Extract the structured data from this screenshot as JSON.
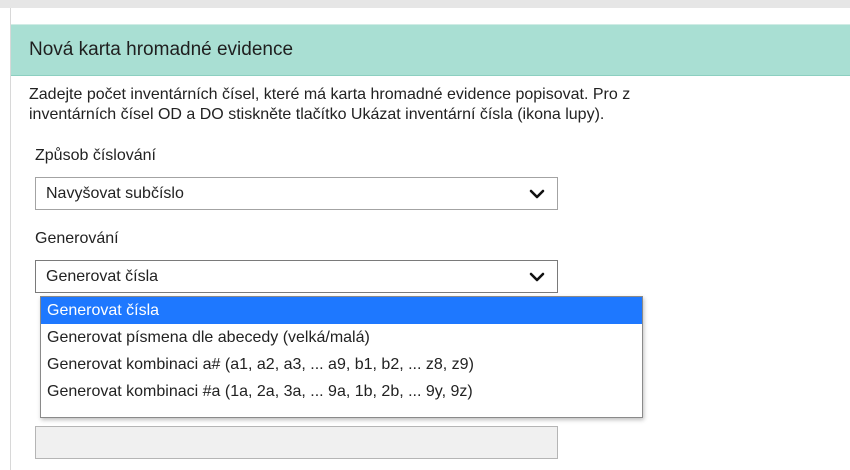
{
  "panel": {
    "title": "Nová karta hromadné evidence",
    "description_line1": "Zadejte počet inventárních čísel, které má karta hromadné evidence popisovat. Pro z",
    "description_line2": "inventárních čísel OD a DO stiskněte tlačítko Ukázat inventární čísla (ikona lupy)."
  },
  "numbering": {
    "label": "Způsob číslování",
    "value": "Navyšovat subčíslo"
  },
  "generation": {
    "label": "Generování",
    "value": "Generovat čísla",
    "options": [
      "Generovat čísla",
      "Generovat písmena dle abecedy (velká/malá)",
      "Generovat kombinaci a# (a1, a2, a3, ... a9, b1, b2, ... z8, z9)",
      "Generovat kombinaci #a (1a, 2a, 3a, ... 9a, 1b, 2b, ... 9y, 9z)"
    ],
    "selected_index": 0
  },
  "colors": {
    "header_bg": "#a9dfd3",
    "selected_option_bg": "#1e78ff"
  },
  "icons": {
    "select_arrow": "chevron-down-icon"
  }
}
